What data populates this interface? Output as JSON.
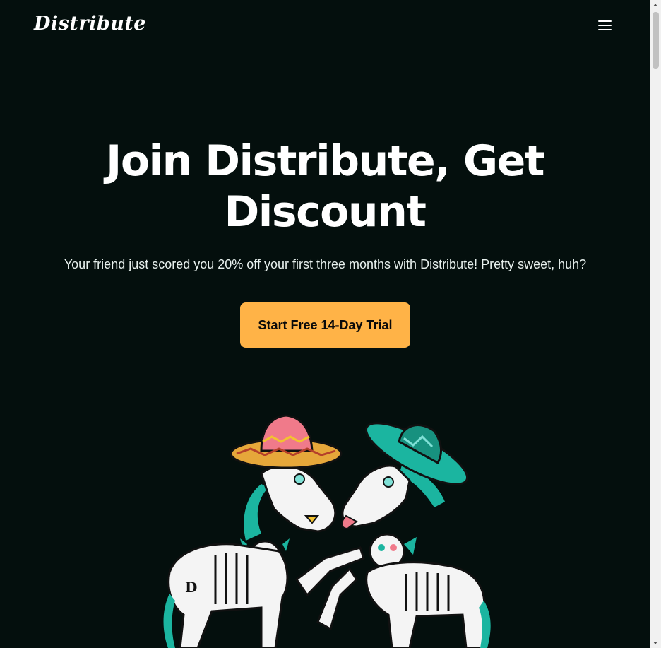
{
  "header": {
    "logo_text": "Distribute",
    "menu_icon": "hamburger-menu-icon"
  },
  "hero": {
    "title": "Join Distribute, Get Discount",
    "subtitle": "Your friend just scored you 20% off your first three months with Distribute! Pretty sweet, huh?",
    "cta_label": "Start Free 14-Day Trial"
  },
  "illustration": {
    "subject": "two-skeleton-horses-with-sombreros"
  },
  "colors": {
    "background": "#040f0d",
    "accent": "#ffb347",
    "teal": "#1bb5a0",
    "text": "#ffffff"
  }
}
